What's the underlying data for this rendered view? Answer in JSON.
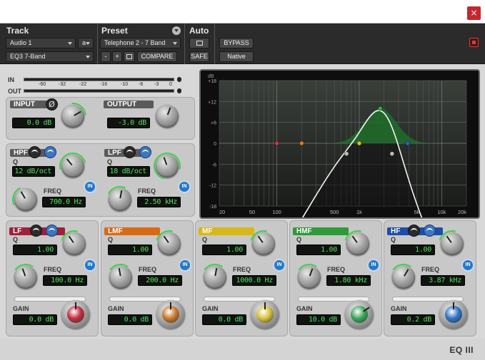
{
  "window": {
    "close_glyph": "×"
  },
  "header": {
    "track_label": "Track",
    "preset_label": "Preset",
    "auto_label": "Auto",
    "track_name": "Audio 1",
    "track_group": "a",
    "plugin_name": "EQ3 7-Band",
    "preset_name": "Telephone 2 - 7 Band",
    "prev_label": "-",
    "next_label": "+",
    "compare_label": "COMPARE",
    "bypass_label": "BYPASS",
    "safe_label": "SAFE",
    "native_label": "Native"
  },
  "meters": {
    "in_label": "IN",
    "out_label": "OUT",
    "ticks": [
      "-60",
      "-32",
      "-22",
      "-16",
      "-10",
      "-6",
      "-3",
      "0"
    ]
  },
  "input": {
    "label": "INPUT",
    "value": "0.0 dB",
    "phase_glyph": "Ø"
  },
  "output": {
    "label": "OUTPUT",
    "value": "-3.0 dB"
  },
  "hpf": {
    "label": "HPF",
    "q_label": "Q",
    "q_value": "12 dB/oct",
    "freq_label": "FREQ",
    "freq_value": "700.0 Hz",
    "in_label": "IN"
  },
  "lpf": {
    "label": "LPF",
    "q_label": "Q",
    "q_value": "18 dB/oct",
    "freq_label": "FREQ",
    "freq_value": "2.50 kHz",
    "in_label": "IN"
  },
  "bands": [
    {
      "label": "LF",
      "q": "1.00",
      "freq": "100.0 Hz",
      "gain": "0.0 dB",
      "color": "#a0203a",
      "cap": "#c42d3f"
    },
    {
      "label": "LMF",
      "q": "1.00",
      "freq": "200.0 Hz",
      "gain": "0.0 dB",
      "color": "#d86a16",
      "cap": "#c97a2a"
    },
    {
      "label": "MF",
      "q": "1.00",
      "freq": "1000.0 Hz",
      "gain": "0.0 dB",
      "color": "#d8b816",
      "cap": "#d6c43a"
    },
    {
      "label": "HMF",
      "q": "1.00",
      "freq": "1.80 kHz",
      "gain": "10.0 dB",
      "color": "#2e9a3a",
      "cap": "#3aa858"
    },
    {
      "label": "HF",
      "q": "1.00",
      "freq": "3.87 kHz",
      "gain": "0.2 dB",
      "color": "#1e4ea8",
      "cap": "#2f73c6"
    }
  ],
  "band_labels": {
    "q": "Q",
    "freq": "FREQ",
    "gain": "GAIN",
    "in": "IN"
  },
  "graph": {
    "db_label": "dB",
    "db_ticks": [
      "+18",
      "+12",
      "+6",
      "0",
      "-6",
      "-12",
      "-18"
    ],
    "freq_ticks": [
      "20",
      "50",
      "100",
      "500",
      "1k",
      "5k",
      "10k",
      "20k"
    ]
  },
  "footer": {
    "logo": "EQ III"
  }
}
